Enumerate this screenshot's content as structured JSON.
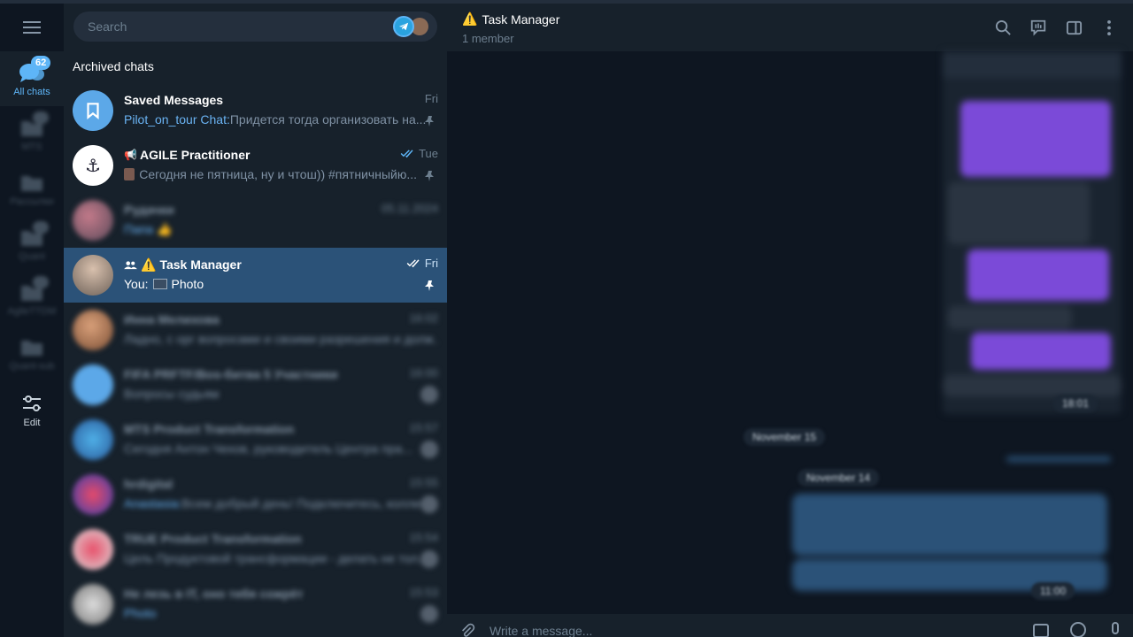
{
  "folders": {
    "menu_icon": "hamburger-icon",
    "items": [
      {
        "label": "All chats",
        "badge": "62",
        "icon": "chats-icon",
        "active": true
      },
      {
        "label": "MTS",
        "icon": "folder-icon"
      },
      {
        "label": "Рассылки",
        "icon": "folder-icon"
      },
      {
        "label": "Quant",
        "icon": "folder-icon"
      },
      {
        "label": "AgileTTDM",
        "icon": "folder-icon"
      },
      {
        "label": "Quant-sub",
        "icon": "folder-icon"
      }
    ],
    "edit_label": "Edit"
  },
  "search": {
    "placeholder": "Search"
  },
  "section": {
    "archived": "Archived chats"
  },
  "chats": [
    {
      "title": "Saved Messages",
      "time": "Fri",
      "sender": "Pilot_on_tour Chat:",
      "preview": " Придется тогда организовать на...",
      "pinned": true
    },
    {
      "title": "AGILE Practitioner",
      "title_prefix": "📢",
      "time": "Tue",
      "preview": "Сегодня не пятница, ну и чтош)) #пятничныйю...",
      "pinned": true
    },
    {
      "title": "Рудачки",
      "time": "05.11.2024",
      "preview": "Папа 👍"
    },
    {
      "title": "Task Manager",
      "title_prefix": "⚠️",
      "time": "Fri",
      "sender": "You:",
      "preview": "Photo",
      "pinned": true
    },
    {
      "title": "Инна Мелихова",
      "time": "16:02",
      "preview": "Ладно, с орг вопросами и своими разрешения и долж..."
    },
    {
      "title": "FIFA PRFTF/Bos-битва 5 Участники",
      "time": "16:00",
      "preview": "Вопросы судьям"
    },
    {
      "title": "MTS Product Transformation",
      "time": "15:57",
      "preview": "Сегодня Антон Чехов, руководитель Центра пра..."
    },
    {
      "title": "hrdigital",
      "time": "15:55",
      "sender": "Anastasia:",
      "preview": " Всем добрый день! Подключитесь, коллеги..."
    },
    {
      "title": "TRUE Product Transformation",
      "time": "15:54",
      "preview": "Цель Продуктовой трансформации - делать не тол..."
    },
    {
      "title": "Не лезь в IT, оно тебя сожрёт",
      "time": "15:53",
      "preview": "Photo"
    }
  ],
  "conversation": {
    "title": "Task Manager",
    "title_prefix": "⚠️",
    "subtitle": "1 member",
    "dates": [
      "November 15",
      "November 14"
    ],
    "times": [
      "18:01",
      "11:00"
    ],
    "composer_placeholder": "Write a message..."
  },
  "colors": {
    "accent": "#5eb5f7",
    "selected": "#2b5278",
    "sidebar_bg": "#17212b",
    "bg": "#0e1621"
  }
}
